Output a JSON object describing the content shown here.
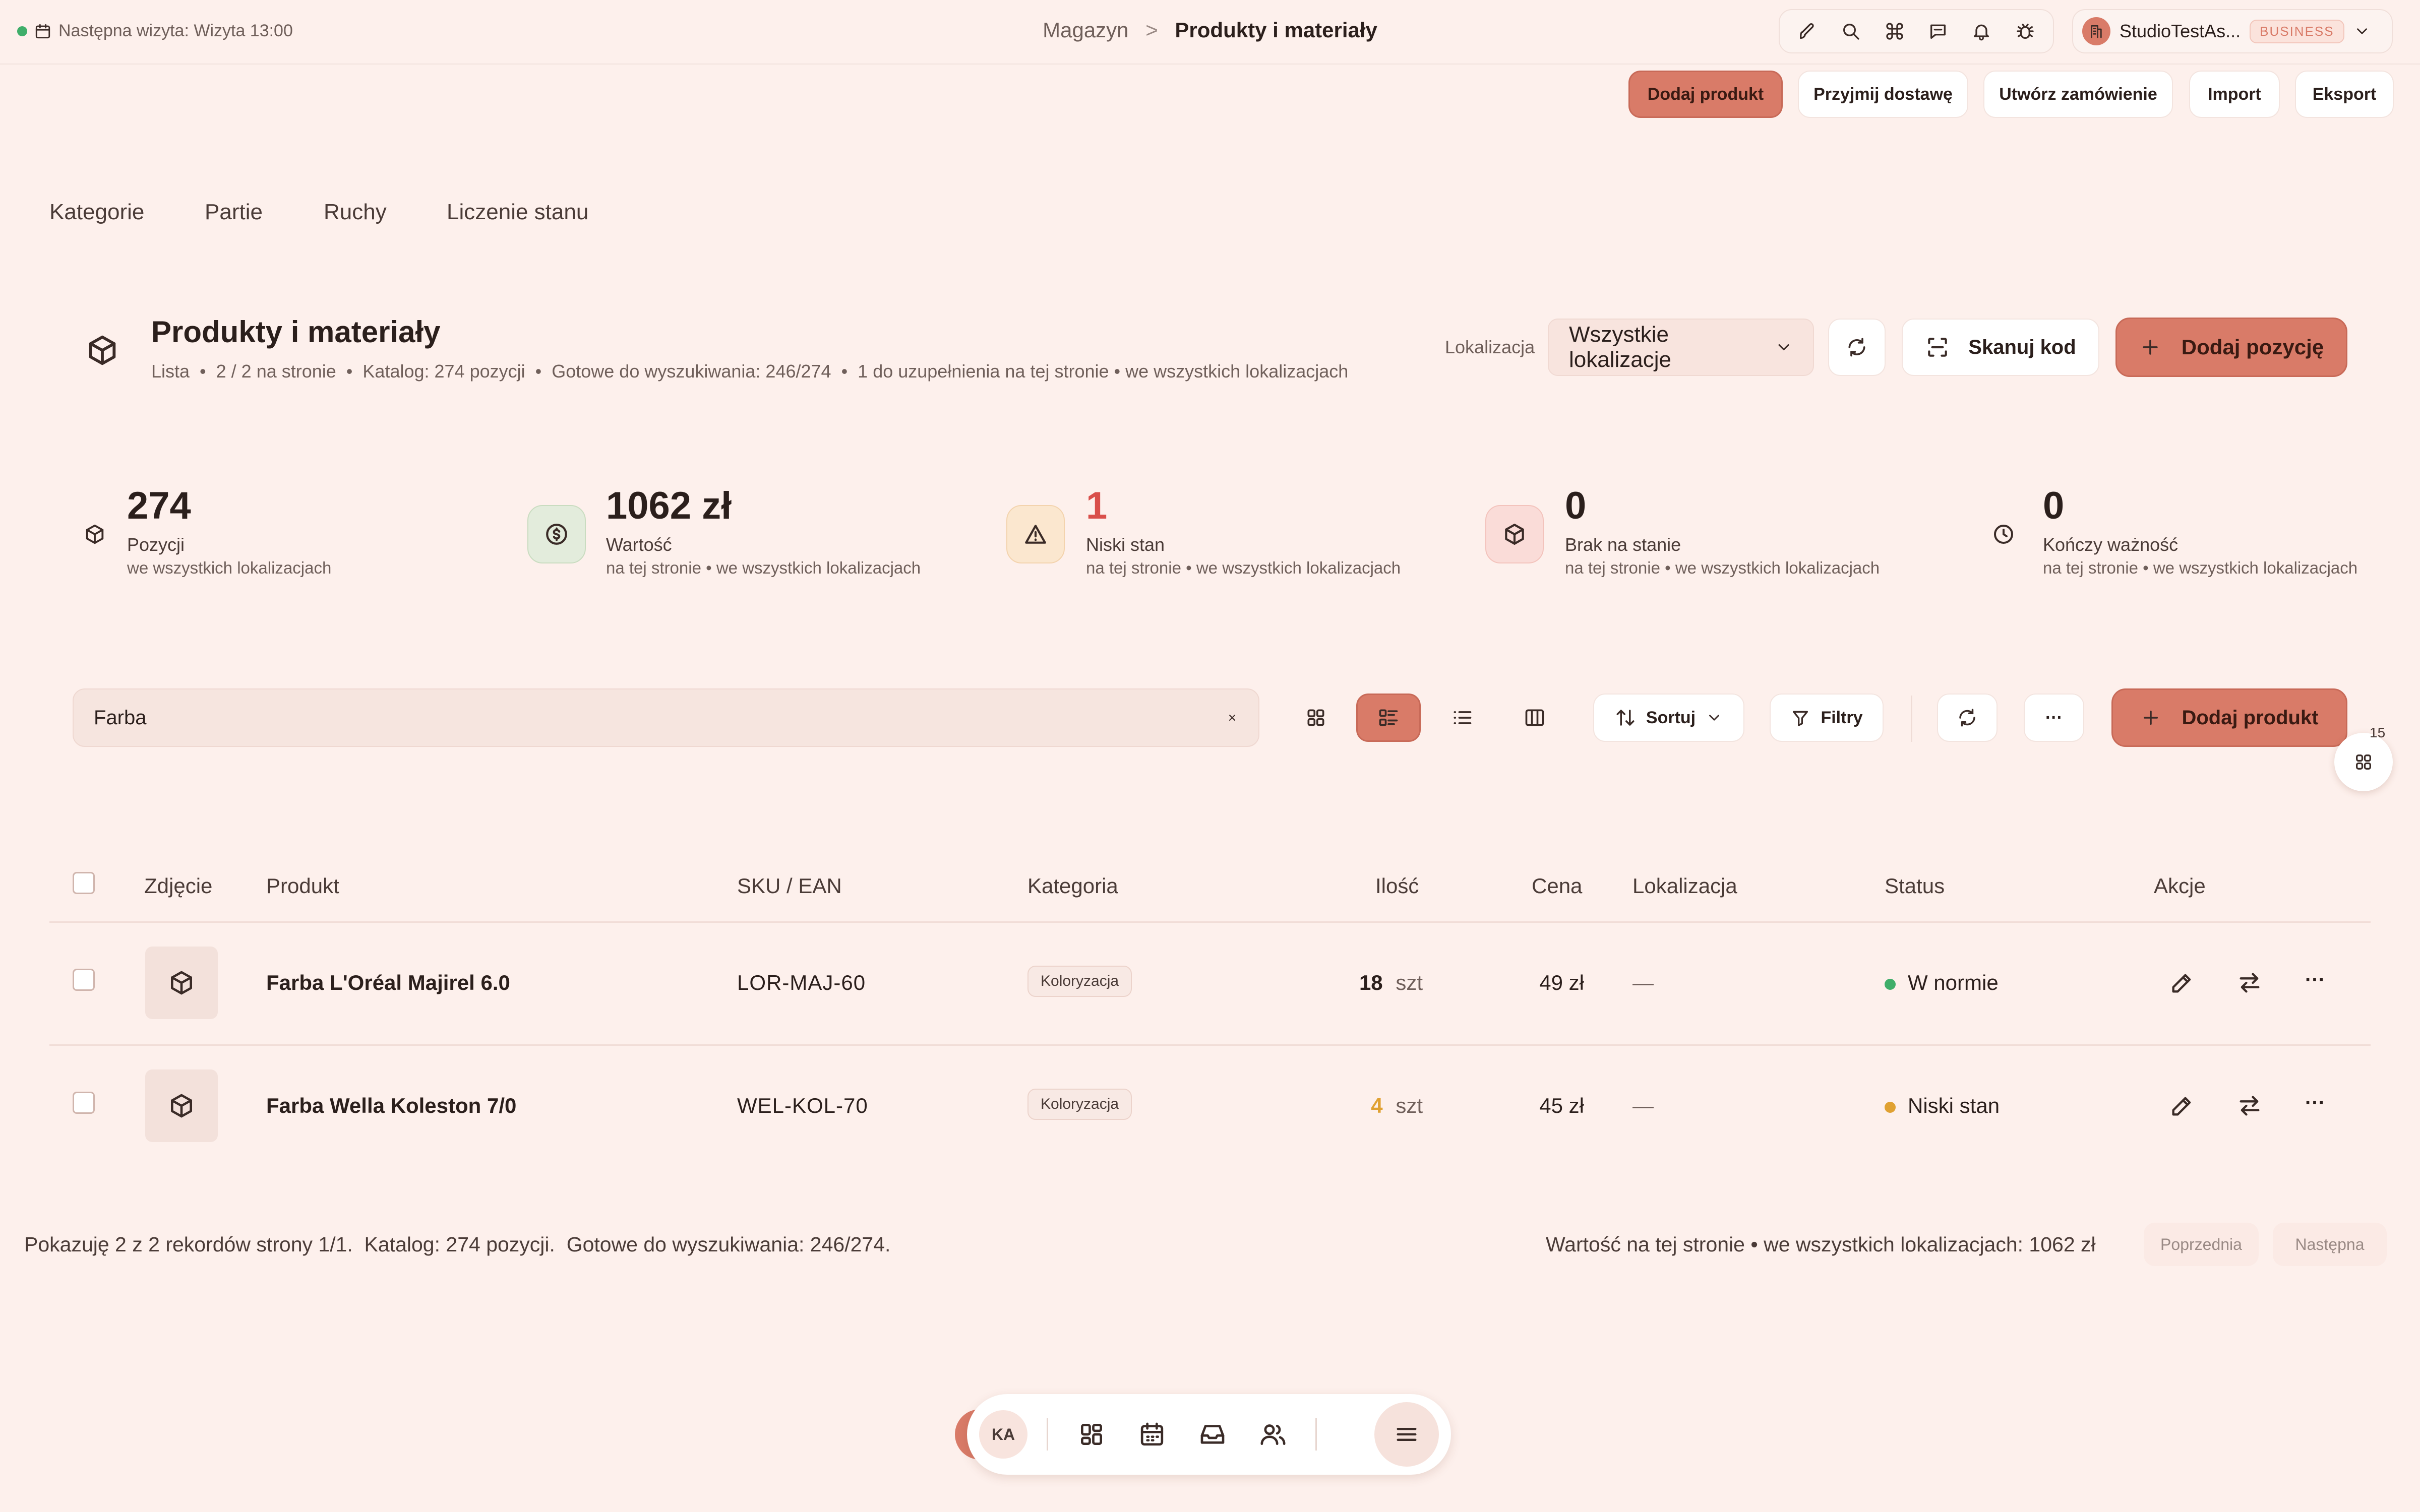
{
  "topbar": {
    "visit_text": "Następna wizyta: Wizyta 13:00",
    "breadcrumb_parent": "Magazyn",
    "breadcrumb_separator": ">",
    "breadcrumb_current": "Produkty i materiały",
    "icons": [
      "brush-icon",
      "search-icon",
      "command-icon",
      "chat-icon",
      "bell-icon",
      "bug-icon"
    ],
    "studio_name": "StudioTestAs...",
    "studio_badge": "BUSINESS"
  },
  "actions": {
    "add_product": "Dodaj produkt",
    "receive_delivery": "Przyjmij dostawę",
    "create_order": "Utwórz zamówienie",
    "import": "Import",
    "export": "Eksport"
  },
  "tabs": [
    "Kategorie",
    "Partie",
    "Ruchy",
    "Liczenie stanu"
  ],
  "header": {
    "title": "Produkty i materiały",
    "subtitle": "Lista  •  2 / 2 na stronie  •  Katalog: 274 pozycji  •  Gotowe do wyszukiwania: 246/274  •  1 do uzupełnienia na tej stronie • we wszystkich lokalizacjach",
    "location_label": "Lokalizacja",
    "location_value": "Wszystkie lokalizacje",
    "scan_label": "Skanuj kod",
    "add_item_label": "Dodaj pozycję"
  },
  "stats": [
    {
      "value": "274",
      "label": "Pozycji",
      "sub": "we wszystkich lokalizacjach",
      "icon": "box-icon"
    },
    {
      "value": "1062 zł",
      "label": "Wartość",
      "sub": "na tej stronie • we wszystkich lokalizacjach",
      "icon": "dollar-icon"
    },
    {
      "value": "1",
      "label": "Niski stan",
      "sub": "na tej stronie • we wszystkich lokalizacjach",
      "icon": "warning-icon"
    },
    {
      "value": "0",
      "label": "Brak na stanie",
      "sub": "na tej stronie • we wszystkich lokalizacjach",
      "icon": "box-icon"
    },
    {
      "value": "0",
      "label": "Kończy ważność",
      "sub": "na tej stronie • we wszystkich lokalizacjach",
      "icon": "clock-icon"
    }
  ],
  "colors": {
    "accent": "#d97b68",
    "background": "#fdf0ec",
    "low_stock": "#d94f4a",
    "status_ok": "#3fae6a",
    "status_low": "#e0a132"
  },
  "toolbar": {
    "search_value": "Farba",
    "sort_label": "Sortuj",
    "filters_label": "Filtry",
    "more_label": "···",
    "add_product_label": "Dodaj produkt",
    "fab_count": "15"
  },
  "table": {
    "columns": [
      "Zdjęcie",
      "Produkt",
      "SKU / EAN",
      "Kategoria",
      "Ilość",
      "Cena",
      "Lokalizacja",
      "Status",
      "Akcje"
    ],
    "rows": [
      {
        "product": "Farba L'Oréal Majirel 6.0",
        "sku": "LOR-MAJ-60",
        "category": "Koloryzacja",
        "qty": "18",
        "unit": "szt",
        "price": "49 zł",
        "location": "—",
        "status": "W normie"
      },
      {
        "product": "Farba Wella Koleston 7/0",
        "sku": "WEL-KOL-70",
        "category": "Koloryzacja",
        "qty": "4",
        "unit": "szt",
        "price": "45 zł",
        "location": "—",
        "status": "Niski stan"
      }
    ]
  },
  "footer": {
    "left": "Pokazuję 2 z 2 rekordów strony 1/1.  Katalog: 274 pozycji.  Gotowe do wyszukiwania: 246/274.",
    "right": "Wartość na tej stronie • we wszystkich lokalizacjach: 1062 zł",
    "prev": "Poprzednia",
    "next": "Następna"
  },
  "dock": {
    "avatar": "KA",
    "items": [
      "dashboard-icon",
      "calendar-icon",
      "inbox-icon",
      "users-icon",
      "menu-icon"
    ]
  }
}
